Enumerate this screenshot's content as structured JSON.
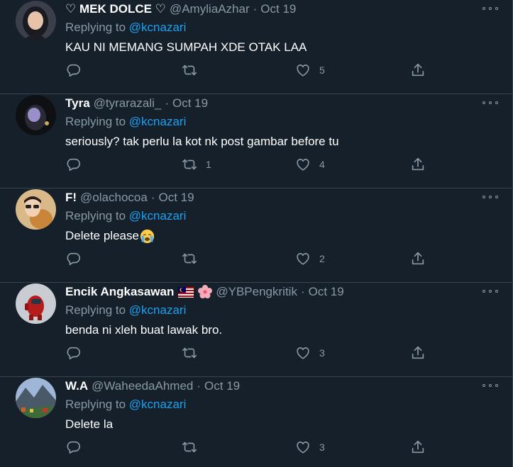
{
  "tweets": [
    {
      "display_name": "♡ MEK DOLCE ♡",
      "handle": "@AmyliaAzhar",
      "date": "Oct 19",
      "replying_prefix": "Replying to ",
      "replying_to": "@kcnazari",
      "text": "KAU NI MEMANG SUMPAH XDE OTAK LAA",
      "reply_count": "",
      "retweet_count": "",
      "like_count": "5"
    },
    {
      "display_name": "Tyra",
      "handle": "@tyrarazali_",
      "date": "Oct 19",
      "replying_prefix": "Replying to ",
      "replying_to": "@kcnazari",
      "text": "seriously? tak perlu la kot nk post gambar before tu",
      "reply_count": "",
      "retweet_count": "1",
      "like_count": "4"
    },
    {
      "display_name": "F!",
      "handle": "@olachocoa",
      "date": "Oct 19",
      "replying_prefix": "Replying to ",
      "replying_to": "@kcnazari",
      "text": "Delete please",
      "reply_count": "",
      "retweet_count": "",
      "like_count": "2"
    },
    {
      "display_name": "Encik Angkasawan",
      "handle": "@YBPengkritik",
      "date": "Oct 19",
      "replying_prefix": "Replying to ",
      "replying_to": "@kcnazari",
      "text": "benda ni xleh buat lawak bro.",
      "reply_count": "",
      "retweet_count": "",
      "like_count": "3"
    },
    {
      "display_name": "W.A",
      "handle": "@WaheedaAhmed",
      "date": "Oct 19",
      "replying_prefix": "Replying to ",
      "replying_to": "@kcnazari",
      "text": "Delete la",
      "reply_count": "",
      "retweet_count": "",
      "like_count": "3"
    }
  ],
  "separator": "·",
  "icons": {
    "reply": "reply-icon",
    "retweet": "retweet-icon",
    "like": "heart-icon",
    "share": "share-icon",
    "more": "more-icon",
    "crying_emoji": "crying-face-emoji",
    "flag": "malaysia-flag-emoji",
    "flower": "hibiscus-emoji"
  },
  "colors": {
    "background": "#15202b",
    "divider": "#38444d",
    "muted": "#8899a6",
    "link": "#1da1f2",
    "text": "#ffffff"
  }
}
